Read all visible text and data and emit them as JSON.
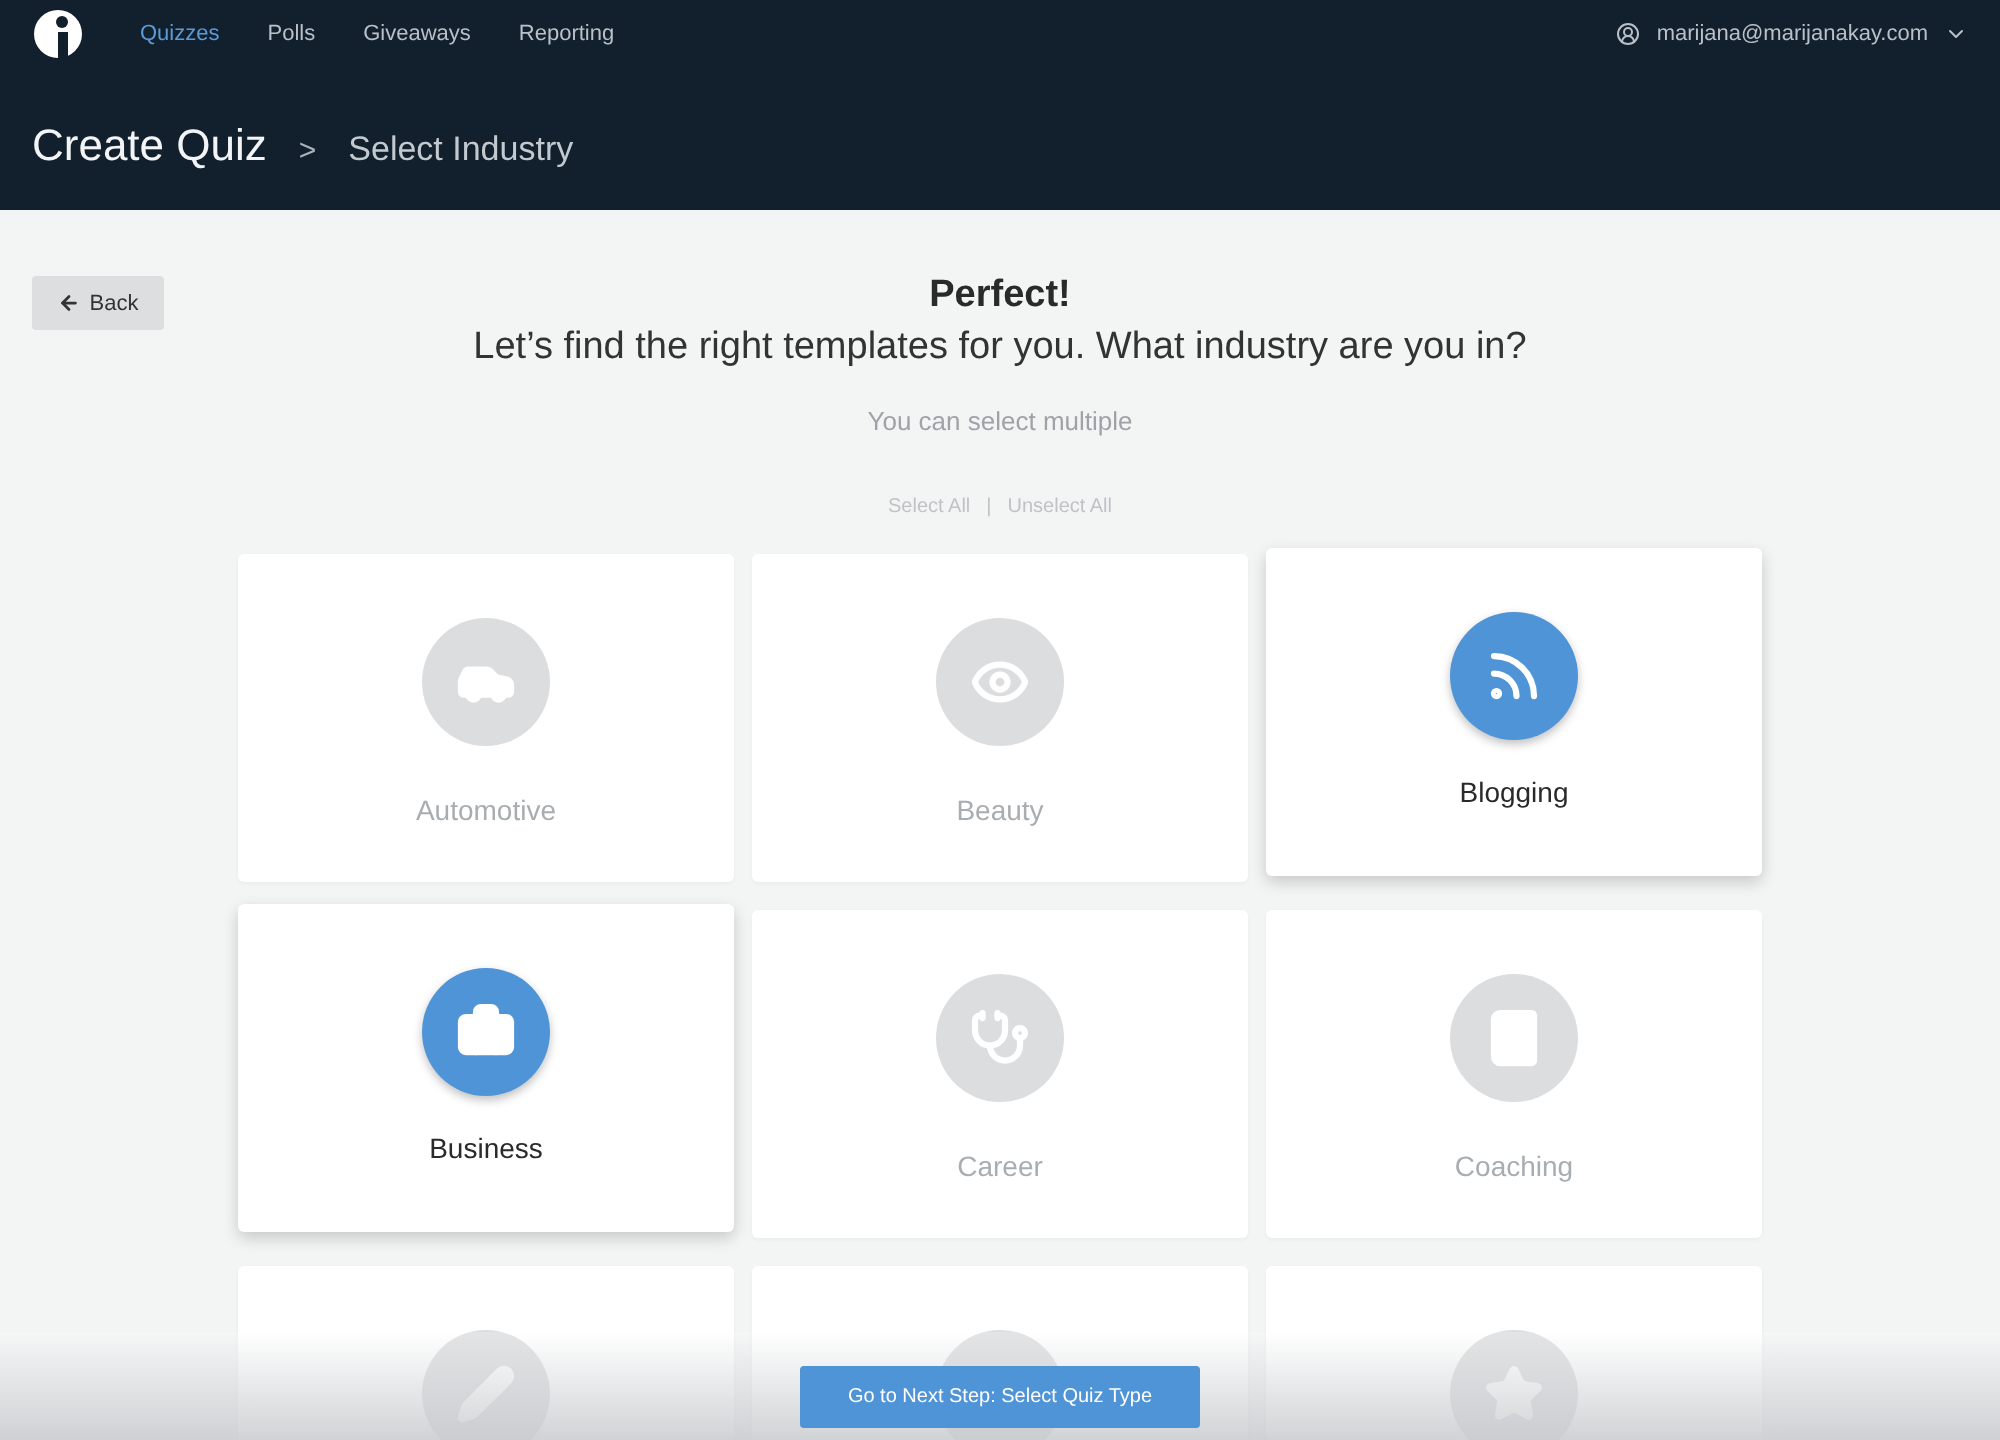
{
  "nav": {
    "items": [
      {
        "label": "Quizzes",
        "selected": true
      },
      {
        "label": "Polls",
        "selected": false
      },
      {
        "label": "Giveaways",
        "selected": false
      },
      {
        "label": "Reporting",
        "selected": false
      }
    ],
    "user": "marijana@marijanakay.com"
  },
  "breadcrumb": {
    "title": "Create Quiz",
    "separator": ">",
    "current": "Select Industry"
  },
  "back_button": "Back",
  "heading": "Perfect!",
  "subheading": "Let’s find the right templates for you. What industry are you in?",
  "hint": "You can select multiple",
  "select_all": "Select All",
  "divider": "|",
  "unselect_all": "Unselect All",
  "cards": [
    {
      "label": "Automotive",
      "selected": false
    },
    {
      "label": "Beauty",
      "selected": false
    },
    {
      "label": "Blogging",
      "selected": true
    },
    {
      "label": "Business",
      "selected": true
    },
    {
      "label": "Career",
      "selected": false
    },
    {
      "label": "Coaching",
      "selected": false
    },
    {
      "selected": false
    },
    {
      "selected": false
    },
    {
      "selected": false
    }
  ],
  "next_button": "Go to Next Step: Select Quiz Type"
}
